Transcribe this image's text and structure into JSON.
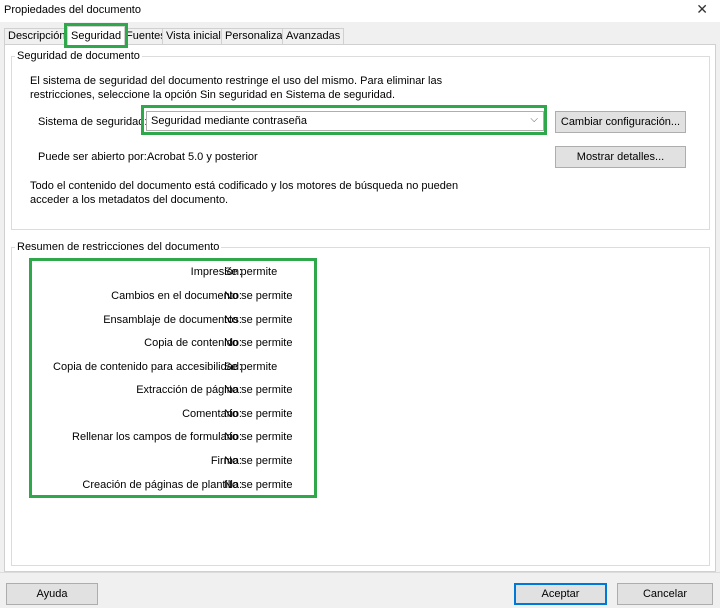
{
  "window": {
    "title": "Propiedades del documento",
    "close_glyph": "✕"
  },
  "tabs": [
    {
      "label": "Descripción"
    },
    {
      "label": "Seguridad"
    },
    {
      "label": "Fuentes"
    },
    {
      "label": "Vista inicial"
    },
    {
      "label": "Personalizar"
    },
    {
      "label": "Avanzadas"
    }
  ],
  "security": {
    "group_title": "Seguridad de documento",
    "description_line1": "El sistema de seguridad del documento restringe el uso del mismo. Para eliminar las",
    "description_line2": "restricciones, seleccione la opción Sin seguridad en Sistema de seguridad.",
    "system_label": "Sistema de seguridad:",
    "system_value": "Seguridad mediante contraseña",
    "change_button": "Cambiar configuración...",
    "open_label": "Puede ser abierto por:",
    "open_value": "Acrobat 5.0 y posterior",
    "details_button": "Mostrar detalles...",
    "note_line1": "Todo el contenido del documento está codificado y los motores de búsqueda no pueden",
    "note_line2": "acceder a los metadatos del documento."
  },
  "restrictions": {
    "group_title": "Resumen de restricciones del documento",
    "rows": [
      {
        "label": "Impresión:",
        "value": "Se permite"
      },
      {
        "label": "Cambios en el documento:",
        "value": "No se permite"
      },
      {
        "label": "Ensamblaje de documentos:",
        "value": "No se permite"
      },
      {
        "label": "Copia de contenido:",
        "value": "No se permite"
      },
      {
        "label": "Copia de contenido para accesibilidad:",
        "value": "Se permite"
      },
      {
        "label": "Extracción de página:",
        "value": "No se permite"
      },
      {
        "label": "Comentario:",
        "value": "No se permite"
      },
      {
        "label": "Rellenar los campos de formulario:",
        "value": "No se permite"
      },
      {
        "label": "Firma:",
        "value": "No se permite"
      },
      {
        "label": "Creación de páginas de plantilla:",
        "value": "No se permite"
      }
    ]
  },
  "footer": {
    "help_button": "Ayuda",
    "ok_button": "Aceptar",
    "cancel_button": "Cancelar"
  },
  "colors": {
    "highlight": "#2ea84a",
    "primary_border": "#0078d7"
  }
}
